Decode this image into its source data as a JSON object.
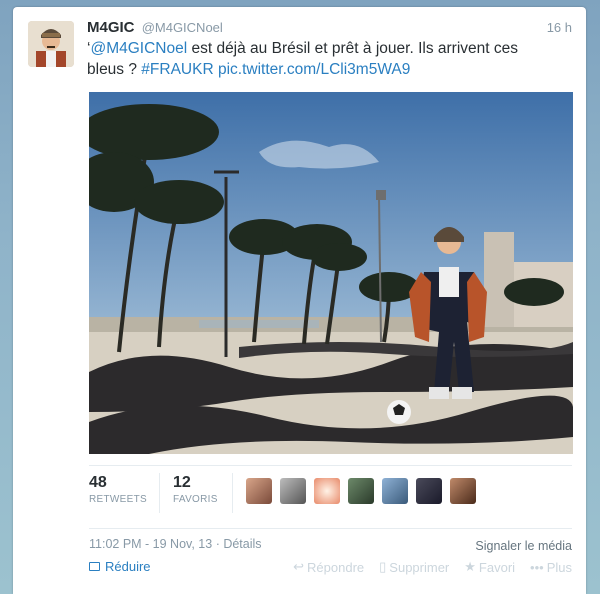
{
  "tweet": {
    "display_name": "M4GIC",
    "handle": "@M4GICNoel",
    "time": "16 h",
    "text_prefix": "‘",
    "mention": "@M4GICNoel",
    "text_body": " est déjà au Brésil et prêt à jouer. Ils arrivent ces bleus ? ",
    "hashtag": "#FRAUKR",
    "media_link": "pic.twitter.com/LCli3m5WA9"
  },
  "stats": {
    "retweets_count": "48",
    "retweets_label": "RETWEETS",
    "favorites_count": "12",
    "favorites_label": "FAVORIS"
  },
  "meta": {
    "timestamp": "11:02 PM - 19 Nov, 13",
    "details": " · Détails",
    "report": "Signaler le média"
  },
  "actions": {
    "collapse": "Réduire",
    "reply": "Répondre",
    "delete": "Supprimer",
    "favorite": "Favori",
    "more": "Plus"
  },
  "icons": {
    "collapse": "media-icon",
    "reply": "reply-icon",
    "delete": "trash-icon",
    "favorite": "star-icon",
    "more": "dots-icon"
  },
  "colors": {
    "link": "#2a7fc1",
    "text": "#292f33",
    "muted": "#8899a6"
  }
}
